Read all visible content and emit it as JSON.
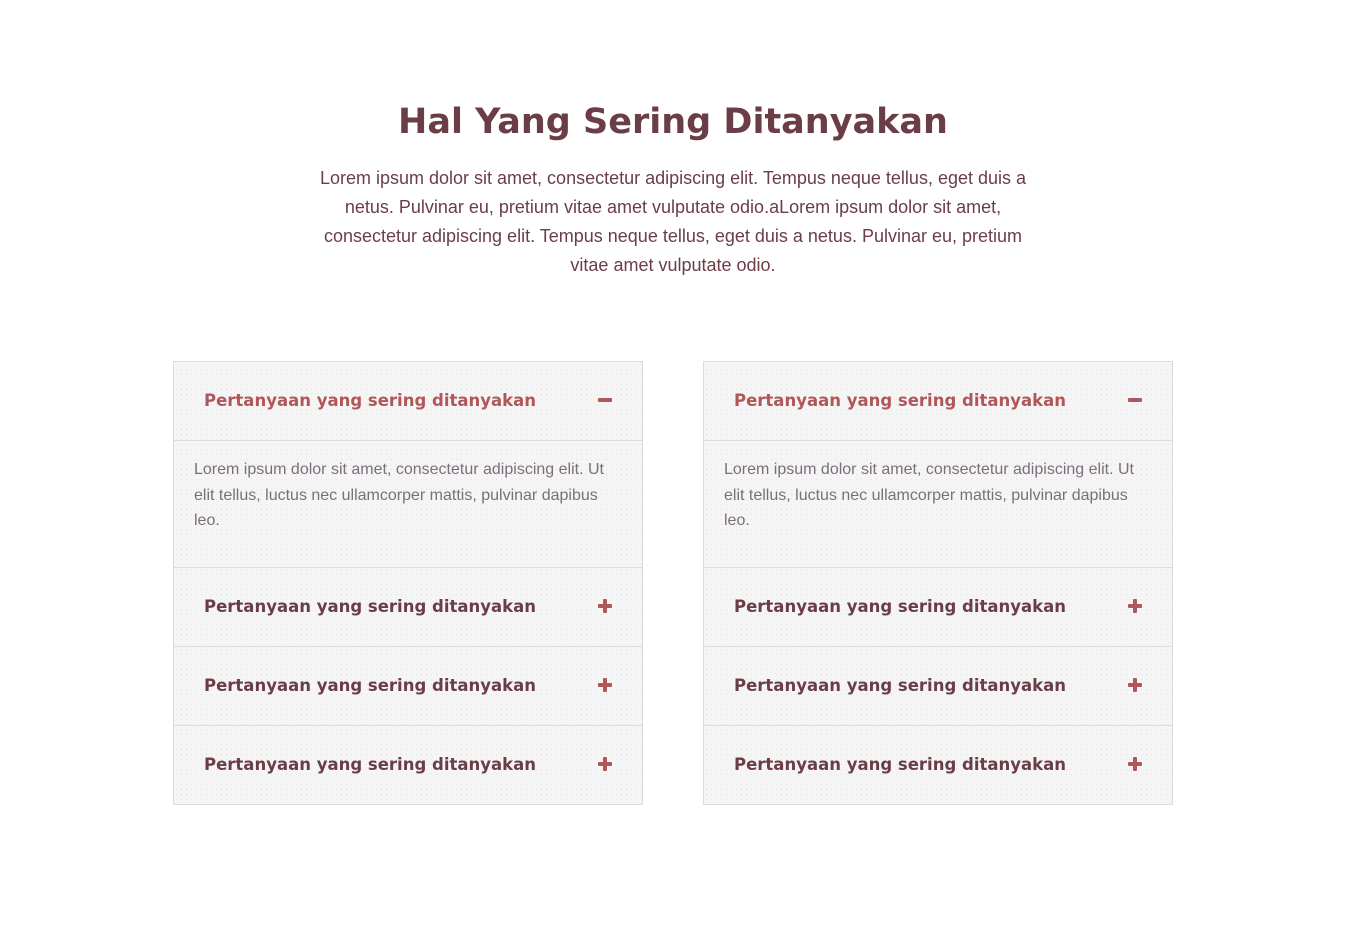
{
  "section": {
    "title": "Hal Yang Sering Ditanyakan",
    "intro": "Lorem ipsum dolor sit amet, consectetur adipiscing elit. Tempus neque tellus, eget duis a netus. Pulvinar eu, pretium vitae amet vulputate odio.aLorem ipsum dolor sit amet, consectetur adipiscing elit. Tempus neque tellus, eget duis a netus. Pulvinar eu, pretium vitae amet vulputate odio."
  },
  "colors": {
    "heading": "#6b3e47",
    "accent": "#b0575a",
    "body_text": "#7b6e7c",
    "panel_bg": "#f6f5f5",
    "border": "#dcdcdc"
  },
  "faq_left": {
    "items": [
      {
        "question": "Pertanyaan yang sering ditanyakan",
        "answer": "Lorem ipsum dolor sit amet, consectetur adipiscing elit. Ut elit tellus, luctus nec ullamcorper mattis, pulvinar dapibus leo.",
        "expanded": true,
        "icon": "minus-icon"
      },
      {
        "question": "Pertanyaan yang sering ditanyakan",
        "expanded": false,
        "icon": "plus-icon"
      },
      {
        "question": "Pertanyaan yang sering ditanyakan",
        "expanded": false,
        "icon": "plus-icon"
      },
      {
        "question": "Pertanyaan yang sering ditanyakan",
        "expanded": false,
        "icon": "plus-icon"
      }
    ]
  },
  "faq_right": {
    "items": [
      {
        "question": "Pertanyaan yang sering ditanyakan",
        "answer": "Lorem ipsum dolor sit amet, consectetur adipiscing elit. Ut elit tellus, luctus nec ullamcorper mattis, pulvinar dapibus leo.",
        "expanded": true,
        "icon": "minus-icon"
      },
      {
        "question": "Pertanyaan yang sering ditanyakan",
        "expanded": false,
        "icon": "plus-icon"
      },
      {
        "question": "Pertanyaan yang sering ditanyakan",
        "expanded": false,
        "icon": "plus-icon"
      },
      {
        "question": "Pertanyaan yang sering ditanyakan",
        "expanded": false,
        "icon": "plus-icon"
      }
    ]
  }
}
